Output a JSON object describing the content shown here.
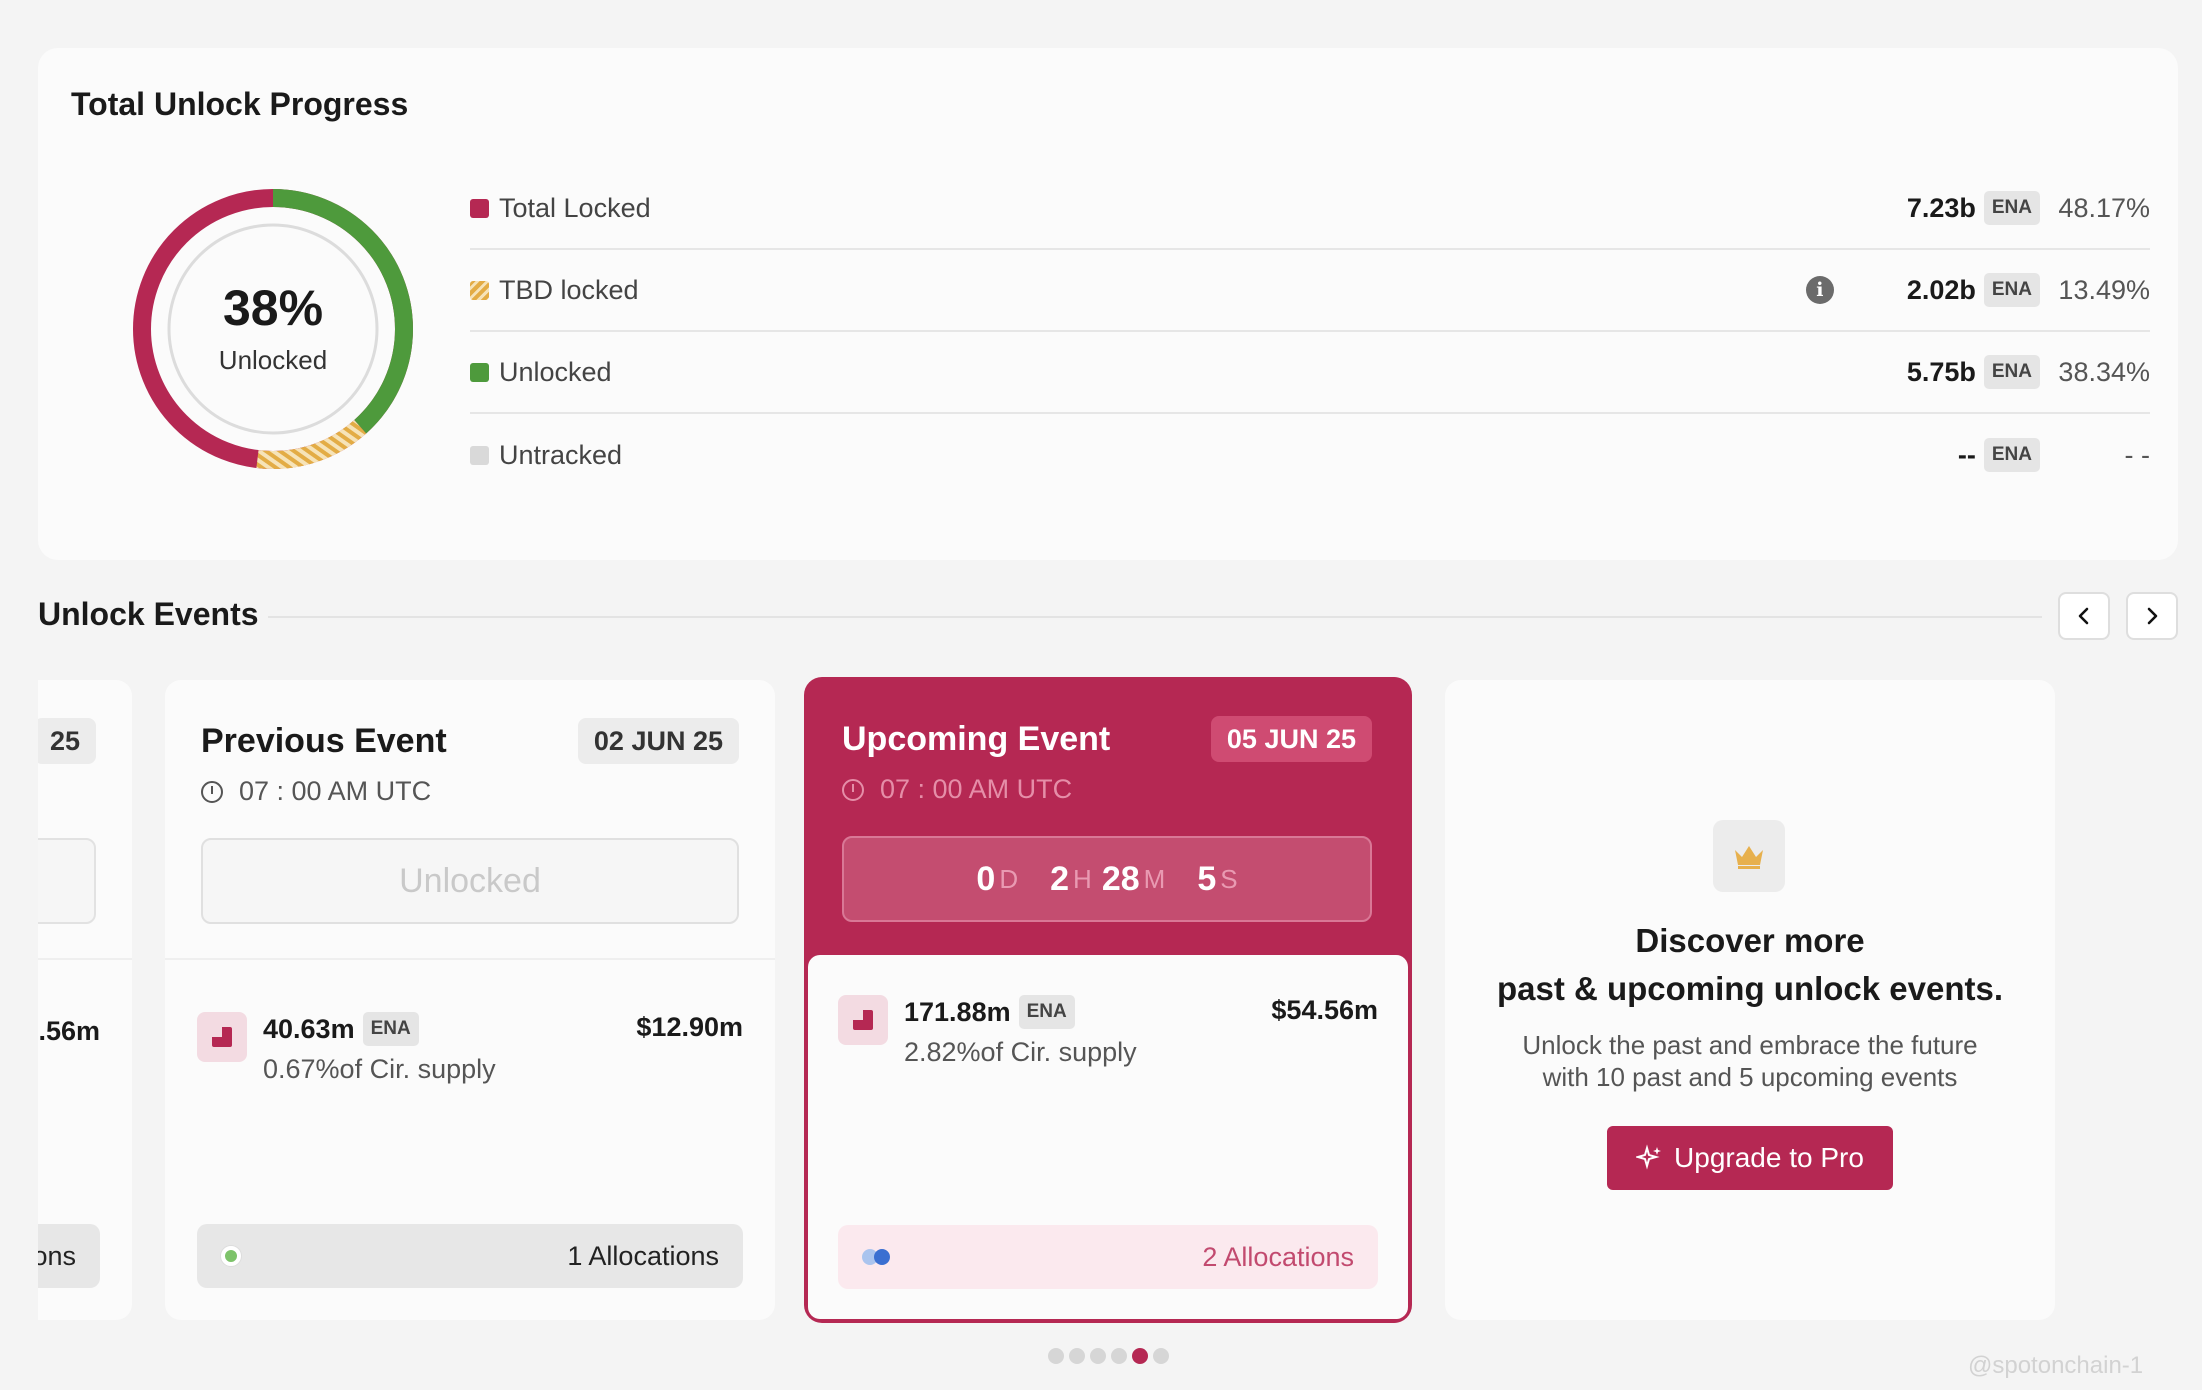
{
  "unlock_progress": {
    "title": "Total Unlock Progress",
    "percent_text": "38%",
    "percent_label": "Unlocked",
    "unlocked_fraction": 0.3834,
    "rows": [
      {
        "name": "Total Locked",
        "value": "7.23b",
        "token": "ENA",
        "pct": "48.17%",
        "color": "#b52853",
        "pattern": "solid"
      },
      {
        "name": "TBD locked",
        "value": "2.02b",
        "token": "ENA",
        "pct": "13.49%",
        "color": "#e8b44f",
        "pattern": "striped",
        "info_icon": "info-icon"
      },
      {
        "name": "Unlocked",
        "value": "5.75b",
        "token": "ENA",
        "pct": "38.34%",
        "color": "#4e9a3c",
        "pattern": "solid"
      },
      {
        "name": "Untracked",
        "value": "--",
        "token": "ENA",
        "pct": "- -",
        "color": "#d9d9d9",
        "pattern": "solid"
      }
    ]
  },
  "events": {
    "title": "Unlock Events",
    "prev_icon": "chevron-left-icon",
    "next_icon": "chevron-right-icon",
    "partial_card": {
      "date": "25",
      "usd": ".56m",
      "alloc_label": "ons"
    },
    "previous": {
      "title": "Previous Event",
      "date": "02 JUN 25",
      "time": "07 : 00 AM UTC",
      "status": "Unlocked",
      "amount": "40.63m",
      "token": "ENA",
      "supply": "0.67%of Cir. supply",
      "usd": "$12.90m",
      "allocations": "1 Allocations"
    },
    "upcoming": {
      "title": "Upcoming Event",
      "date": "05 JUN 25",
      "time": "07 : 00 AM UTC",
      "countdown": {
        "d": "0",
        "d_unit": "D",
        "h": "2",
        "h_unit": "H",
        "m": "28",
        "m_unit": "M",
        "s": "5",
        "s_unit": "S"
      },
      "amount": "171.88m",
      "token": "ENA",
      "supply": "2.82%of Cir. supply",
      "usd": "$54.56m",
      "allocations": "2 Allocations"
    },
    "promo": {
      "icon": "crown-icon",
      "heading_line1": "Discover more",
      "heading_line2": "past & upcoming unlock events.",
      "text_line1": "Unlock the past and embrace the future",
      "text_line2": "with 10 past and 5 upcoming events",
      "button": "Upgrade to Pro",
      "button_icon": "sparkle-icon"
    },
    "pagination": {
      "count": 6,
      "active_index": 4
    }
  },
  "watermark": "@spotonchain-1",
  "colors": {
    "accent": "#b52853",
    "green": "#4e9a3c",
    "tbd": "#e8b44f"
  }
}
